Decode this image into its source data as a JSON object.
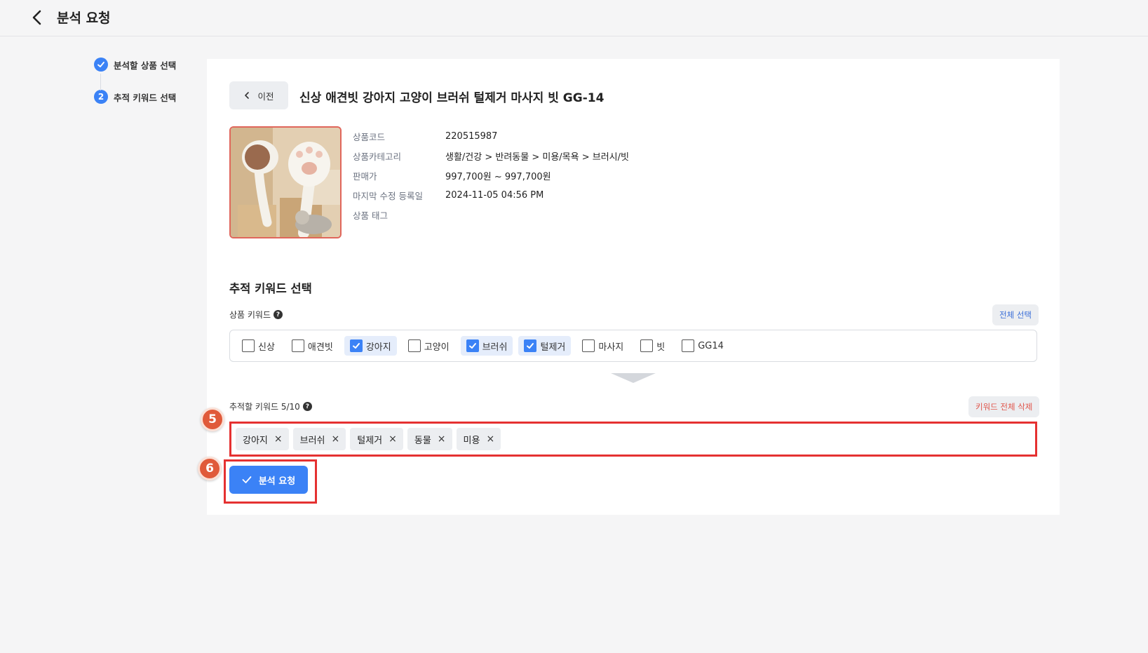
{
  "header": {
    "title": "분석 요청",
    "back_icon": "chevron-left-icon"
  },
  "steps": [
    {
      "label": "분석할 상품 선택",
      "state": "done",
      "mark": ""
    },
    {
      "label": "추적 키워드 선택",
      "state": "active",
      "mark": "2"
    }
  ],
  "product": {
    "prev_label": "이전",
    "title": "신상 애견빗 강아지 고양이 브러쉬 털제거 마사지 빗 GG-14",
    "info": [
      {
        "key": "상품코드",
        "value": "220515987"
      },
      {
        "key": "상품카테고리",
        "value": "생활/건강 > 반려동물 > 미용/목욕 > 브러시/빗"
      },
      {
        "key": "판매가",
        "value": "997,700원 ~ 997,700원"
      },
      {
        "key": "마지막 수정 등록일",
        "value": "2024-11-05 04:56 PM"
      },
      {
        "key": "상품 태그",
        "value": ""
      }
    ]
  },
  "keywords": {
    "section_title": "추적 키워드 선택",
    "product_label": "상품 키워드",
    "select_all": "전체 선택",
    "items": [
      {
        "label": "신상",
        "checked": false
      },
      {
        "label": "애견빗",
        "checked": false
      },
      {
        "label": "강아지",
        "checked": true
      },
      {
        "label": "고양이",
        "checked": false
      },
      {
        "label": "브러쉬",
        "checked": true
      },
      {
        "label": "털제거",
        "checked": true
      },
      {
        "label": "마사지",
        "checked": false
      },
      {
        "label": "빗",
        "checked": false
      },
      {
        "label": "GG14",
        "checked": false
      }
    ],
    "tracking_label": "추적할 키워드 5/10",
    "delete_all": "키워드 전체 삭제",
    "tags": [
      "강아지",
      "브러쉬",
      "털제거",
      "동물",
      "미용"
    ],
    "remove_symbol": "×"
  },
  "submit_label": "분석 요청",
  "markers": [
    "5",
    "6"
  ],
  "colors": {
    "accent": "#3b82f6",
    "highlight": "#e53131",
    "marker": "#e05a3a"
  }
}
